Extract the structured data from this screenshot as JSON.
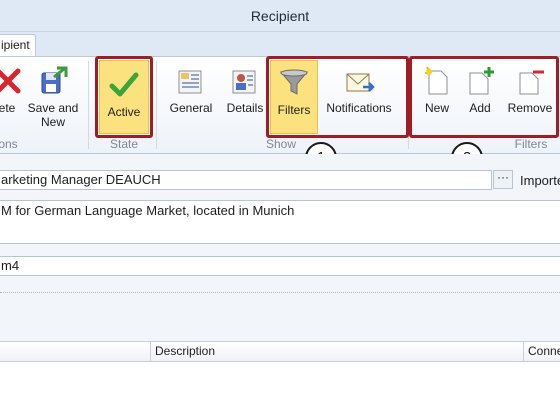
{
  "window": {
    "title": "Recipient"
  },
  "tab": {
    "label": "ipient"
  },
  "ribbon": {
    "buttons": {
      "delete": "ete",
      "save_and_new_line1": "Save and",
      "save_and_new_line2": "New",
      "active": "Active",
      "general": "General",
      "details": "Details",
      "filters": "Filters",
      "notifications": "Notifications",
      "new": "New",
      "add": "Add",
      "remove": "Remove"
    },
    "groups": {
      "actions": "ons",
      "state": "State",
      "show": "Show",
      "filters": "Filters"
    }
  },
  "callouts": {
    "one": "1",
    "two": "2"
  },
  "form": {
    "name_value": "arketing Manager DEAUCH",
    "ellipsis": "···",
    "imported_label": "Importe",
    "description_value": "M for German Language Market, located in Munich",
    "code_value": "m4"
  },
  "grid": {
    "columns": [
      "Description",
      "Conne"
    ]
  },
  "colors": {
    "highlight": "#fbe27e",
    "callout_border": "#a01d26",
    "ribbon_bg": "#eef3f9"
  }
}
